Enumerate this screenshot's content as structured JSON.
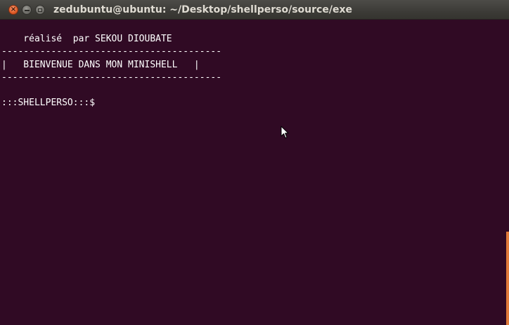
{
  "window": {
    "title": "zedubuntu@ubuntu: ~/Desktop/shellperso/source/exe"
  },
  "titlebar_icons": {
    "close": "close-icon",
    "minimize": "minimize-icon",
    "maximize": "maximize-icon",
    "close_glyph": "×"
  },
  "terminal": {
    "lines": [
      "    réalisé  par SEKOU DIOUBATE",
      "----------------------------------------",
      "|   BIENVENUE DANS MON MINISHELL   |",
      "----------------------------------------",
      ":::SHELLPERSO:::$"
    ]
  },
  "colors": {
    "terminal_bg": "#300a24",
    "terminal_fg": "#ffffff",
    "titlebar_bg": "#3c3b37",
    "title_fg": "#dfdbd2",
    "close_button": "#e05b26",
    "scroll_thumb": "#e07b3a"
  },
  "pointer": {
    "icon": "mouse-pointer-icon"
  }
}
